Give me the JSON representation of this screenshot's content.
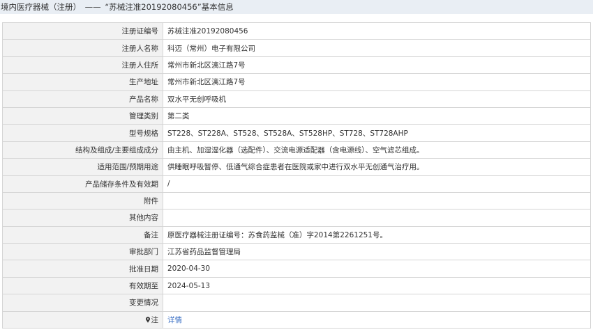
{
  "header": {
    "title": "境内医疗器械（注册）",
    "dash": "——",
    "subtitle": "“苏械注准20192080456”基本信息"
  },
  "rows": [
    {
      "label": "注册证编号",
      "value": "苏械注准20192080456"
    },
    {
      "label": "注册人名称",
      "value": "科迈（常州）电子有限公司"
    },
    {
      "label": "注册人住所",
      "value": "常州市新北区漓江路7号"
    },
    {
      "label": "生产地址",
      "value": "常州市新北区漓江路7号"
    },
    {
      "label": "产品名称",
      "value": "双水平无创呼吸机"
    },
    {
      "label": "管理类别",
      "value": "第二类"
    },
    {
      "label": "型号规格",
      "value": "ST228、ST228A、ST528、ST528A、ST528HP、ST728、ST728AHP"
    },
    {
      "label": "结构及组成/主要组成成分",
      "value": "由主机、加湿湿化器（选配件）、交流电源适配器（含电源线）、空气滤芯组成。"
    },
    {
      "label": "适用范围/预期用途",
      "value": "供睡眠呼吸暂停、低通气综合症患者在医院或家中进行双水平无创通气治疗用。"
    },
    {
      "label": "产品储存条件及有效期",
      "value": "/"
    },
    {
      "label": "附件",
      "value": ""
    },
    {
      "label": "其他内容",
      "value": ""
    },
    {
      "label": "备注",
      "value": "原医疗器械注册证编号：苏食药监械（准）字2014第2261251号。"
    },
    {
      "label": "审批部门",
      "value": "江苏省药品监督管理局"
    },
    {
      "label": "批准日期",
      "value": "2020-04-30"
    },
    {
      "label": "有效期至",
      "value": "2024-05-13"
    },
    {
      "label": "变更情况",
      "value": ""
    }
  ],
  "note_row": {
    "label": "注",
    "icon": "pin-icon",
    "link_text": "详情"
  },
  "colors": {
    "header_bg": "#e9eef4",
    "label_bg": "#f2f2f2",
    "border": "#d5d5d5",
    "link": "#3a6fc4"
  }
}
